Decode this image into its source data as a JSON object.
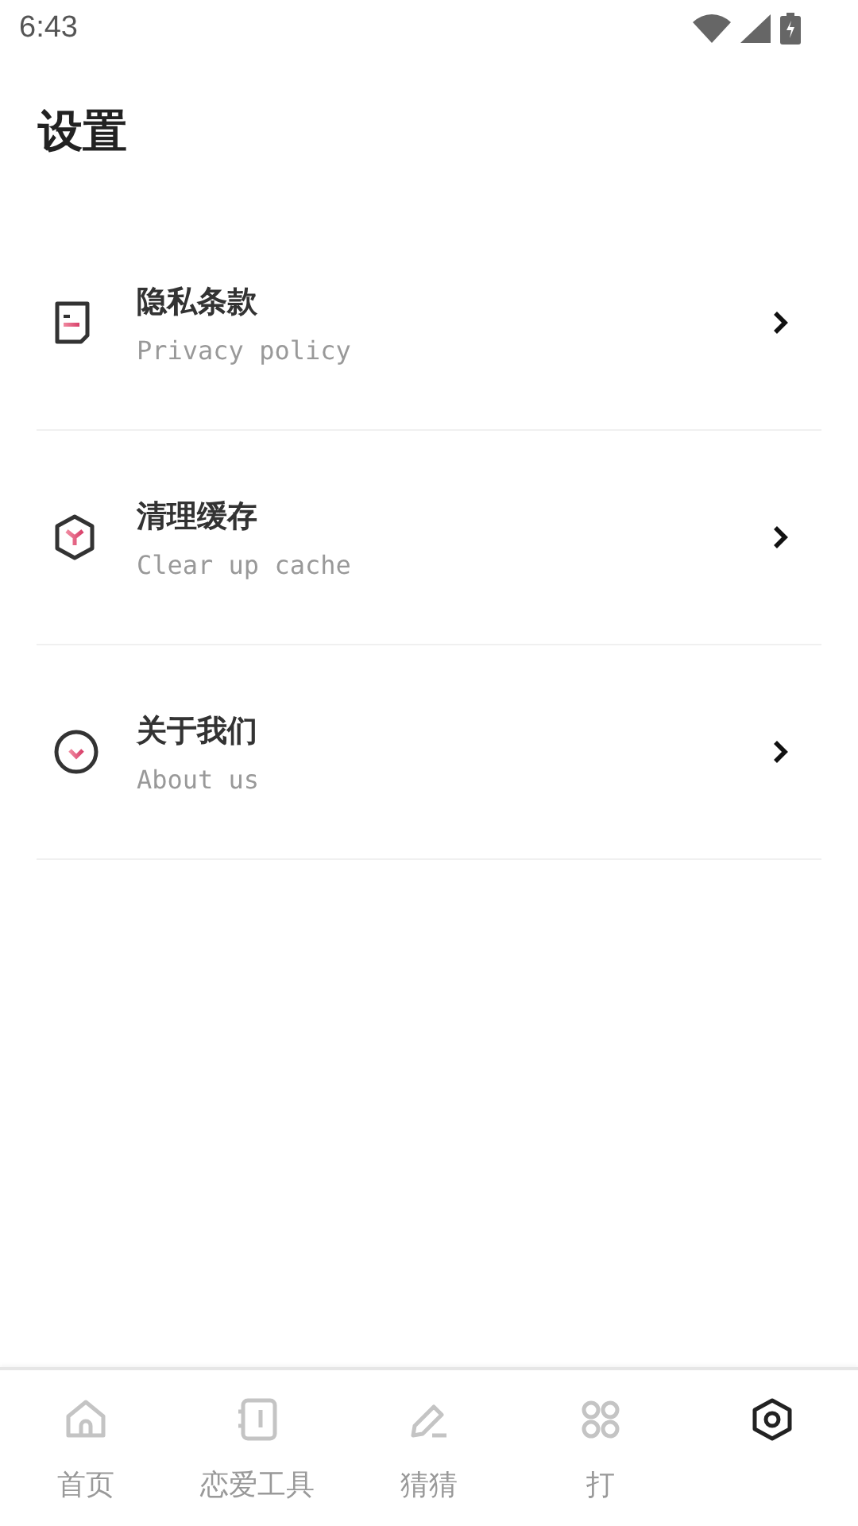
{
  "status_bar": {
    "time": "6:43"
  },
  "title": "设置",
  "items": [
    {
      "kind": "document",
      "title": "隐私条款",
      "subtitle": "Privacy policy"
    },
    {
      "kind": "hexagon",
      "title": "清理缓存",
      "subtitle": "Clear up cache"
    },
    {
      "kind": "circle",
      "title": "关于我们",
      "subtitle": "About us"
    }
  ],
  "tabs": [
    {
      "kind": "home",
      "label": "首页",
      "selected": false
    },
    {
      "kind": "notebook",
      "label": "恋爱工具",
      "selected": false
    },
    {
      "kind": "pencil",
      "label": "猜猜",
      "selected": false
    },
    {
      "kind": "grid",
      "label": "打",
      "selected": false
    },
    {
      "kind": "settings",
      "selected": true
    }
  ]
}
